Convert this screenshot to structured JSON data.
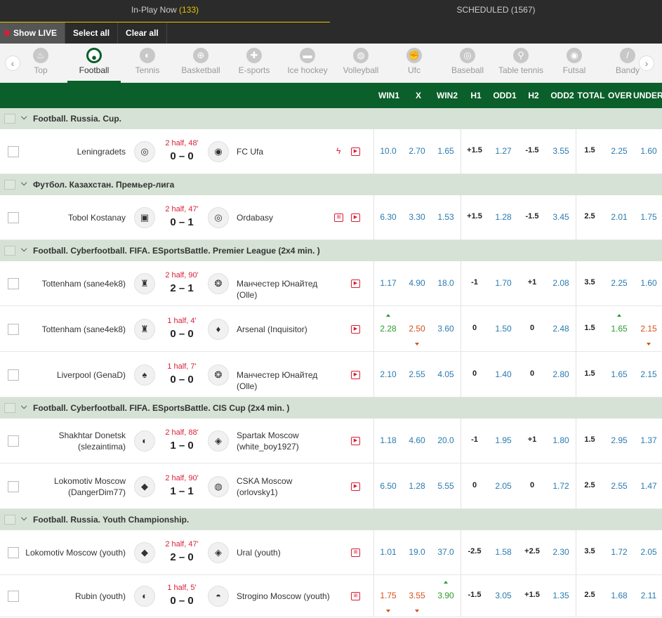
{
  "tabs": {
    "inplay_label": "In-Play Now",
    "inplay_count": "(133)",
    "scheduled_label": "SCHEDULED (1567)"
  },
  "filters": {
    "show_live": "Show LIVE",
    "select_all": "Select all",
    "clear_all": "Clear all"
  },
  "sports": [
    {
      "label": "Top",
      "icon": "flame-icon"
    },
    {
      "label": "Football",
      "icon": "soccer-ball-icon"
    },
    {
      "label": "Tennis",
      "icon": "tennis-ball-icon"
    },
    {
      "label": "Basketball",
      "icon": "basketball-icon"
    },
    {
      "label": "E-sports",
      "icon": "gamepad-icon"
    },
    {
      "label": "Ice hockey",
      "icon": "hockey-puck-icon"
    },
    {
      "label": "Volleyball",
      "icon": "volleyball-icon"
    },
    {
      "label": "Ufc",
      "icon": "glove-icon"
    },
    {
      "label": "Baseball",
      "icon": "baseball-icon"
    },
    {
      "label": "Table tennis",
      "icon": "ping-pong-icon"
    },
    {
      "label": "Futsal",
      "icon": "futsal-ball-icon"
    },
    {
      "label": "Bandy",
      "icon": "bandy-stick-icon"
    }
  ],
  "columns": [
    "WIN1",
    "X",
    "WIN2",
    "H1",
    "ODD1",
    "H2",
    "ODD2",
    "TOTAL",
    "OVER",
    "UNDER"
  ],
  "leagues": [
    {
      "title": "Football. Russia. Cup."
    },
    {
      "title": "Футбол. Казахстан. Премьер-лига"
    },
    {
      "title": "Football. Cyberfootball. FIFA. ESportsBattle. Premier League (2x4 min. )"
    },
    {
      "title": "Football. Cyberfootball. FIFA. ESportsBattle. CIS Cup (2x4 min. )"
    },
    {
      "title": "Football. Russia. Youth Championship."
    }
  ],
  "matches": [
    {
      "team1": "Leningradets",
      "team2": "FC Ufa",
      "time": "2 half, 48'",
      "score": "0 – 0",
      "odds": [
        "10.0",
        "2.70",
        "1.65",
        "+1.5",
        "1.27",
        "-1.5",
        "3.55",
        "1.5",
        "2.25",
        "1.60"
      ]
    },
    {
      "team1": "Tobol Kostanay",
      "team2": "Ordabasy",
      "time": "2 half, 47'",
      "score": "0 – 1",
      "odds": [
        "6.30",
        "3.30",
        "1.53",
        "+1.5",
        "1.28",
        "-1.5",
        "3.45",
        "2.5",
        "2.01",
        "1.75"
      ]
    },
    {
      "team1": "Tottenham (sane4ek8)",
      "team2": "Манчестер Юнайтед (Olle)",
      "time": "2 half, 90'",
      "score": "2 – 1",
      "odds": [
        "1.17",
        "4.90",
        "18.0",
        "-1",
        "1.70",
        "+1",
        "2.08",
        "3.5",
        "2.25",
        "1.60"
      ]
    },
    {
      "team1": "Tottenham (sane4ek8)",
      "team2": "Arsenal (Inquisitor)",
      "time": "1 half, 4'",
      "score": "0 – 0",
      "odds": [
        "2.28",
        "2.50",
        "3.60",
        "0",
        "1.50",
        "0",
        "2.48",
        "1.5",
        "1.65",
        "2.15"
      ]
    },
    {
      "team1": "Liverpool (GenaD)",
      "team2": "Манчестер Юнайтед (Olle)",
      "time": "1 half, 7'",
      "score": "0 – 0",
      "odds": [
        "2.10",
        "2.55",
        "4.05",
        "0",
        "1.40",
        "0",
        "2.80",
        "1.5",
        "1.65",
        "2.15"
      ]
    },
    {
      "team1": "Shakhtar Donetsk (slezaintima)",
      "team2": "Spartak Moscow (white_boy1927)",
      "time": "2 half, 88'",
      "score": "1 – 0",
      "odds": [
        "1.18",
        "4.60",
        "20.0",
        "-1",
        "1.95",
        "+1",
        "1.80",
        "1.5",
        "2.95",
        "1.37"
      ]
    },
    {
      "team1": "Lokomotiv Moscow (DangerDim77)",
      "team2": "CSKA Moscow (orlovsky1)",
      "time": "2 half, 90'",
      "score": "1 – 1",
      "odds": [
        "6.50",
        "1.28",
        "5.55",
        "0",
        "2.05",
        "0",
        "1.72",
        "2.5",
        "2.55",
        "1.47"
      ]
    },
    {
      "team1": "Lokomotiv Moscow (youth)",
      "team2": "Ural (youth)",
      "time": "2 half, 47'",
      "score": "2 – 0",
      "odds": [
        "1.01",
        "19.0",
        "37.0",
        "-2.5",
        "1.58",
        "+2.5",
        "2.30",
        "3.5",
        "1.72",
        "2.05"
      ]
    },
    {
      "team1": "Rubin (youth)",
      "team2": "Strogino Moscow (youth)",
      "time": "1 half, 5'",
      "score": "0 – 0",
      "odds": [
        "1.75",
        "3.55",
        "3.90",
        "-1.5",
        "3.05",
        "+1.5",
        "1.35",
        "2.5",
        "1.68",
        "2.11"
      ]
    }
  ],
  "colors": {
    "green": "#0b5f2a",
    "league_bg": "#d6e2d5",
    "red": "#d81e35",
    "odds_blue": "#2a7ab0",
    "up": "#2a9d2a",
    "down": "#d4511b",
    "accent_yellow": "#e5c400"
  }
}
